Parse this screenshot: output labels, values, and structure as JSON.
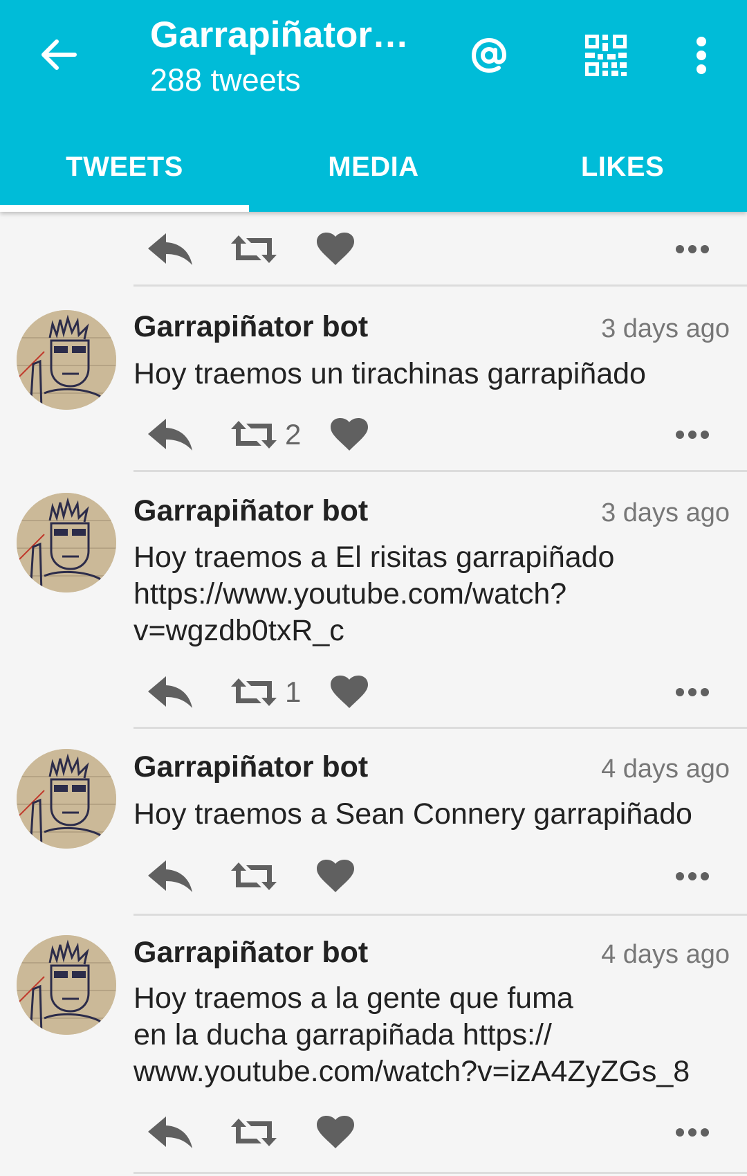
{
  "header": {
    "title": "Garrapiñator…",
    "subtitle": "288 tweets",
    "colors": {
      "accent": "#00bcd8",
      "text": "#ffffff"
    },
    "icons": [
      "back-arrow-icon",
      "at-sign-icon",
      "qr-code-icon",
      "more-vert-icon"
    ]
  },
  "tabs": [
    {
      "label": "TWEETS",
      "active": true
    },
    {
      "label": "MEDIA",
      "active": false
    },
    {
      "label": "LIKES",
      "active": false
    }
  ],
  "tweets": [
    {
      "name": "Garrapiñator bot",
      "time": "3 days ago",
      "text": "Hoy traemos un tirachinas garrapiñado",
      "retweets": "2",
      "likes": ""
    },
    {
      "name": "Garrapiñator bot",
      "time": "3 days ago",
      "text": "Hoy traemos a El risitas garrapiñado\nhttps://www.youtube.com/watch?\nv=wgzdb0txR_c",
      "retweets": "1",
      "likes": ""
    },
    {
      "name": "Garrapiñator bot",
      "time": "4 days ago",
      "text": "Hoy traemos a Sean Connery garrapiñado",
      "retweets": "",
      "likes": ""
    },
    {
      "name": "Garrapiñator bot",
      "time": "4 days ago",
      "text": "Hoy traemos a la gente que fuma\nen la ducha garrapiñada https://\nwww.youtube.com/watch?v=izA4ZyZGs_8",
      "retweets": "",
      "likes": ""
    }
  ]
}
